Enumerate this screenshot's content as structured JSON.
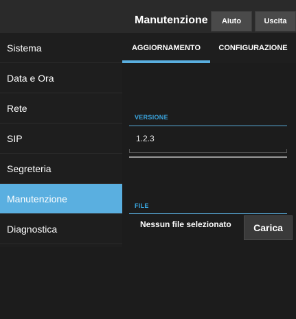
{
  "header": {
    "title": "Manutenzione",
    "help_label": "Aiuto",
    "exit_label": "Uscita"
  },
  "sidebar": {
    "items": [
      {
        "label": "Sistema"
      },
      {
        "label": "Data e Ora"
      },
      {
        "label": "Rete"
      },
      {
        "label": "SIP"
      },
      {
        "label": "Segreteria"
      },
      {
        "label": "Manutenzione"
      },
      {
        "label": "Diagnostica"
      }
    ],
    "active_index": 5
  },
  "tabs": [
    {
      "label": "AGGIORNAMENTO"
    },
    {
      "label": "CONFIGURAZIONE"
    }
  ],
  "version": {
    "label": "VERSIONE",
    "value": "1.2.3"
  },
  "file": {
    "label": "FILE",
    "status_text": "Nessun file selezionato",
    "upload_label": "Carica"
  },
  "colors": {
    "accent": "#5aafe0",
    "background": "#1c1c1c"
  }
}
